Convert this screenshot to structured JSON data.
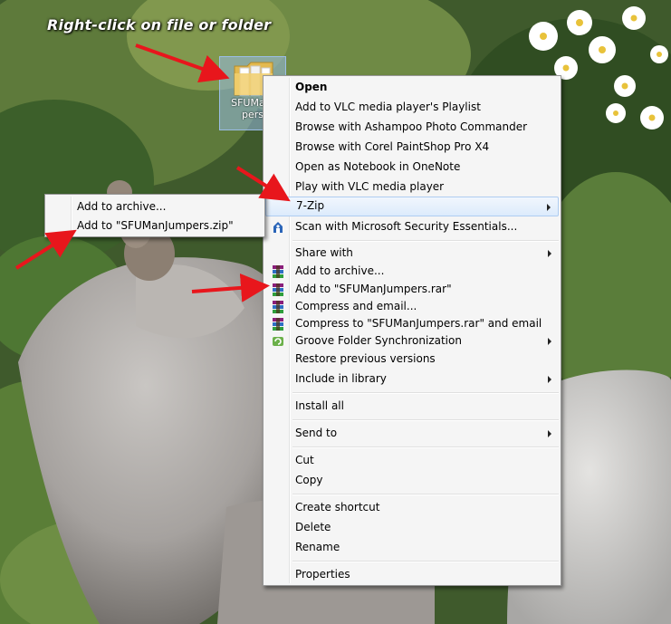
{
  "caption": "Right-click on file or folder",
  "desktop_icon": {
    "name_line1": "SFUManJ",
    "name_line2": "pers"
  },
  "context_menu": {
    "items": [
      {
        "label": "Open",
        "bold": true
      },
      {
        "label": "Add to VLC media player's Playlist"
      },
      {
        "label": "Browse with Ashampoo Photo Commander"
      },
      {
        "label": "Browse with Corel PaintShop Pro X4"
      },
      {
        "label": "Open as Notebook in OneNote"
      },
      {
        "label": "Play with VLC media player"
      },
      {
        "label": "7-Zip",
        "submenu": true,
        "highlighted": true
      },
      {
        "label": "Scan with Microsoft Security Essentials...",
        "icon": "security-shield-icon"
      },
      {
        "label": "Share with",
        "submenu": true
      },
      {
        "label": "Add to archive...",
        "icon": "winrar-icon"
      },
      {
        "label": "Add to \"SFUManJumpers.rar\"",
        "icon": "winrar-icon"
      },
      {
        "label": "Compress and email...",
        "icon": "winrar-icon"
      },
      {
        "label": "Compress to \"SFUManJumpers.rar\" and email",
        "icon": "winrar-icon"
      },
      {
        "label": "Groove Folder Synchronization",
        "submenu": true,
        "icon": "groove-sync-icon"
      },
      {
        "label": "Restore previous versions"
      },
      {
        "label": "Include in library",
        "submenu": true
      },
      {
        "label": "Install all"
      },
      {
        "label": "Send to",
        "submenu": true
      },
      {
        "label": "Cut"
      },
      {
        "label": "Copy"
      },
      {
        "label": "Create shortcut"
      },
      {
        "label": "Delete"
      },
      {
        "label": "Rename"
      },
      {
        "label": "Properties"
      }
    ]
  },
  "zip_submenu": {
    "items": [
      {
        "label": "Add to archive..."
      },
      {
        "label": "Add to \"SFUManJumpers.zip\""
      }
    ]
  },
  "colors": {
    "annotation_arrow": "#e8161c",
    "highlight": "#dcebfc",
    "menu_bg": "#f5f5f5"
  }
}
